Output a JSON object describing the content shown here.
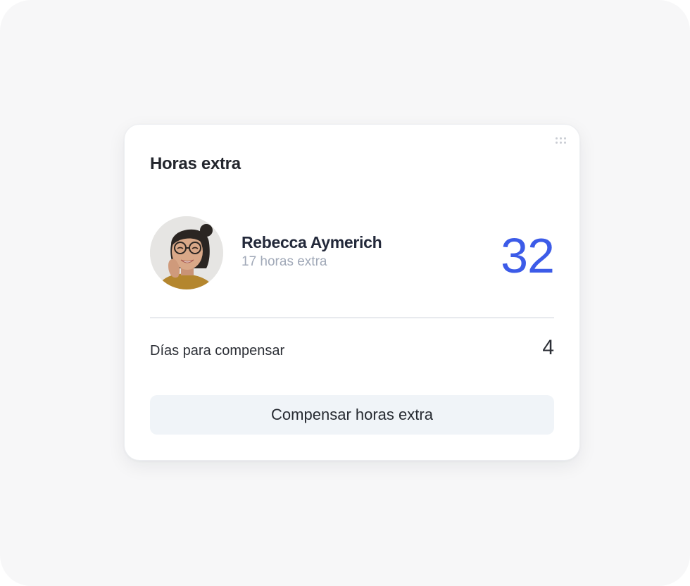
{
  "widget": {
    "title": "Horas extra",
    "menu_icon": "drag-dots-icon"
  },
  "employee": {
    "name": "Rebecca Aymerich",
    "subtitle": "17 horas extra",
    "total": "32"
  },
  "compensation": {
    "label": "Días para compensar",
    "value": "4"
  },
  "action": {
    "label": "Compensar horas extra"
  },
  "colors": {
    "accent": "#3c5be8",
    "button_bg": "#f0f4f8",
    "muted_text": "#a1a9b8",
    "background": "#f7f7f8"
  }
}
